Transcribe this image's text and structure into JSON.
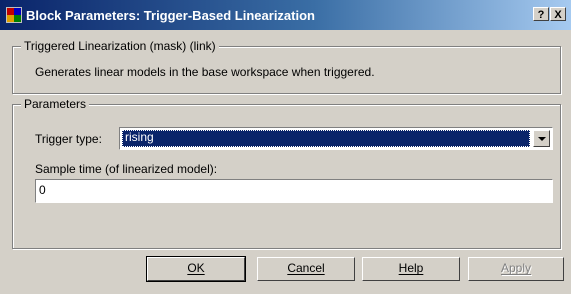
{
  "window": {
    "title": "Block Parameters: Trigger-Based Linearization",
    "help_button": "?",
    "close_button": "X"
  },
  "description_group": {
    "legend": "Triggered Linearization (mask) (link)",
    "text": "Generates linear models in the base workspace when triggered."
  },
  "parameters_group": {
    "legend": "Parameters",
    "trigger_type_label": "Trigger type:",
    "trigger_type_value": "rising",
    "sample_time_label": "Sample time (of linearized model):",
    "sample_time_value": "0"
  },
  "buttons": {
    "ok": "OK",
    "cancel": "Cancel",
    "help": "Help",
    "apply": "Apply"
  }
}
